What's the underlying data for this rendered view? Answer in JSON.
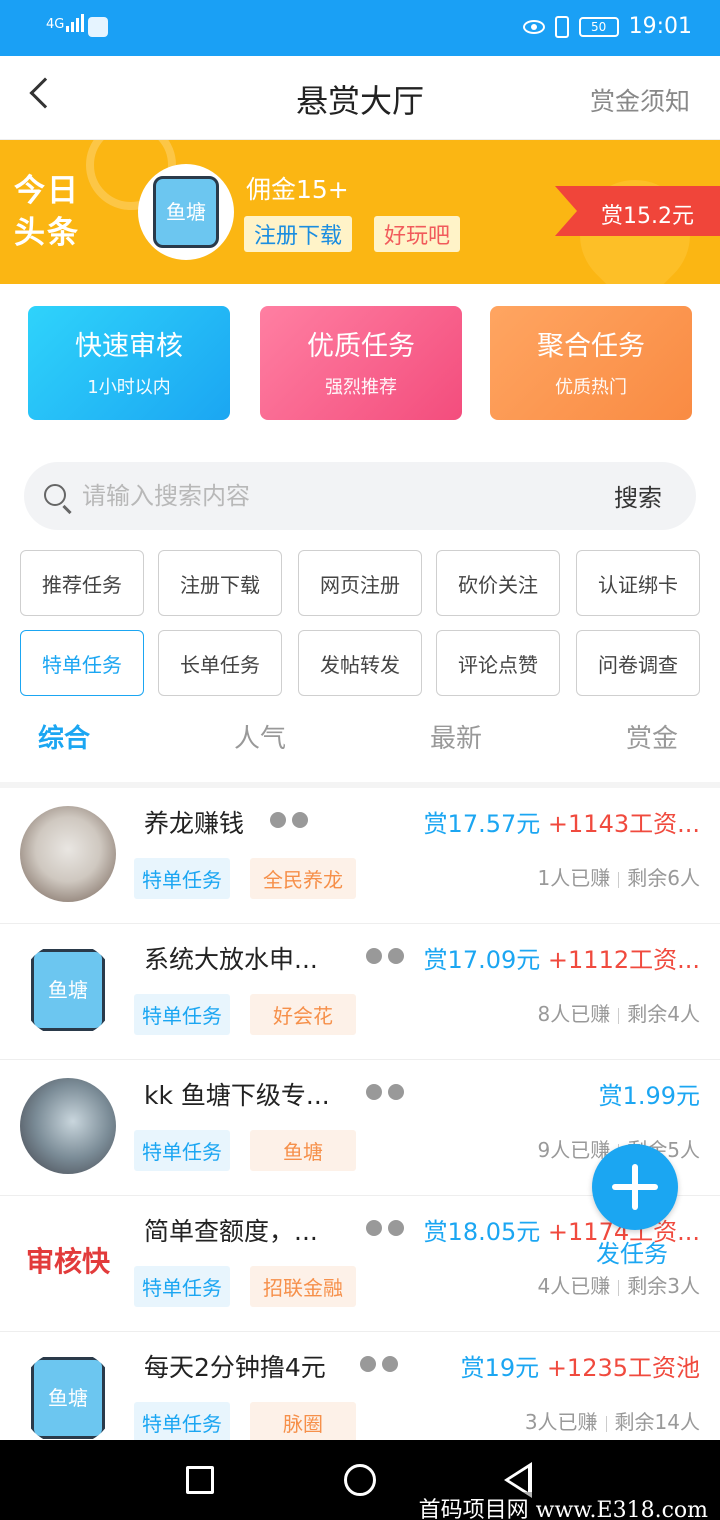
{
  "status_bar": {
    "network": "4G",
    "battery": "50",
    "time": "19:01"
  },
  "header": {
    "title": "悬赏大厅",
    "notice_link": "赏金须知"
  },
  "banner": {
    "label": "今日头条",
    "avatar_text": "鱼塘",
    "headline": "佣金15+",
    "tags": [
      "注册下载",
      "好玩吧"
    ],
    "reward": "赏15.2元"
  },
  "cards": [
    {
      "title": "快速审核",
      "subtitle": "1小时以内",
      "color": "#1ba6f2"
    },
    {
      "title": "优质任务",
      "subtitle": "强烈推荐",
      "color": "#f34d7d"
    },
    {
      "title": "聚合任务",
      "subtitle": "优质热门",
      "color": "#f98b43"
    }
  ],
  "search": {
    "placeholder": "请输入搜索内容",
    "button": "搜索"
  },
  "filters": [
    "推荐任务",
    "注册下载",
    "网页注册",
    "砍价关注",
    "认证绑卡",
    "特单任务",
    "长单任务",
    "发帖转发",
    "评论点赞",
    "问卷调查"
  ],
  "active_filter": "特单任务",
  "sort_tabs": [
    "综合",
    "人气",
    "最新",
    "赏金"
  ],
  "active_sort": "综合",
  "tasks": [
    {
      "name": "养龙赚钱",
      "price": "赏17.57元",
      "pool": "+1143工资...",
      "tag": "特单任务",
      "category": "全民养龙",
      "earned": "1人已赚",
      "remaining": "剩余6人"
    },
    {
      "name": "系统大放水申...",
      "price": "赏17.09元",
      "pool": "+1112工资...",
      "tag": "特单任务",
      "category": "好会花",
      "earned": "8人已赚",
      "remaining": "剩余4人"
    },
    {
      "name": "kk 鱼塘下级专...",
      "price": "赏1.99元",
      "pool": "",
      "tag": "特单任务",
      "category": "鱼塘",
      "earned": "9人已赚",
      "remaining": "剩余5人"
    },
    {
      "name": "简单查额度，...",
      "price": "赏18.05元",
      "pool": "+1174工资...",
      "tag": "特单任务",
      "category": "招联金融",
      "earned": "4人已赚",
      "remaining": "剩余3人",
      "thumb_text": "审核快"
    },
    {
      "name": "每天2分钟撸4元",
      "price": "赏19元",
      "pool": "+1235工资池",
      "tag": "特单任务",
      "category": "脉圈",
      "earned": "3人已赚",
      "remaining": "剩余14人"
    }
  ],
  "fab_label": "发任务",
  "watermark": "首码项目网 www.E318.com",
  "colors": {
    "accent": "#1ba6f2",
    "banner": "#fbb613",
    "reward": "#f0453a",
    "pool": "#f04a3e"
  }
}
